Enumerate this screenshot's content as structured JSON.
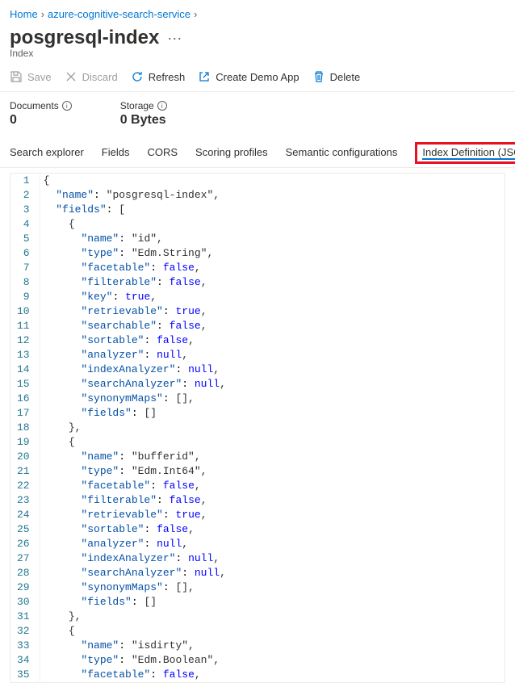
{
  "breadcrumb": {
    "home": "Home",
    "service": "azure-cognitive-search-service"
  },
  "title": "posgresql-index",
  "subtitle": "Index",
  "toolbar": {
    "save": "Save",
    "discard": "Discard",
    "refresh": "Refresh",
    "createDemo": "Create Demo App",
    "delete": "Delete"
  },
  "stats": {
    "docs_label": "Documents",
    "docs_value": "0",
    "storage_label": "Storage",
    "storage_value": "0 Bytes"
  },
  "tabs": {
    "searchExplorer": "Search explorer",
    "fields": "Fields",
    "cors": "CORS",
    "scoring": "Scoring profiles",
    "semantic": "Semantic configurations",
    "json": "Index Definition (JSON)"
  },
  "editor_lines": [
    "{",
    "  \"name\": \"posgresql-index\",",
    "  \"fields\": [",
    "    {",
    "      \"name\": \"id\",",
    "      \"type\": \"Edm.String\",",
    "      \"facetable\": false,",
    "      \"filterable\": false,",
    "      \"key\": true,",
    "      \"retrievable\": true,",
    "      \"searchable\": false,",
    "      \"sortable\": false,",
    "      \"analyzer\": null,",
    "      \"indexAnalyzer\": null,",
    "      \"searchAnalyzer\": null,",
    "      \"synonymMaps\": [],",
    "      \"fields\": []",
    "    },",
    "    {",
    "      \"name\": \"bufferid\",",
    "      \"type\": \"Edm.Int64\",",
    "      \"facetable\": false,",
    "      \"filterable\": false,",
    "      \"retrievable\": true,",
    "      \"sortable\": false,",
    "      \"analyzer\": null,",
    "      \"indexAnalyzer\": null,",
    "      \"searchAnalyzer\": null,",
    "      \"synonymMaps\": [],",
    "      \"fields\": []",
    "    },",
    "    {",
    "      \"name\": \"isdirty\",",
    "      \"type\": \"Edm.Boolean\",",
    "      \"facetable\": false,"
  ]
}
